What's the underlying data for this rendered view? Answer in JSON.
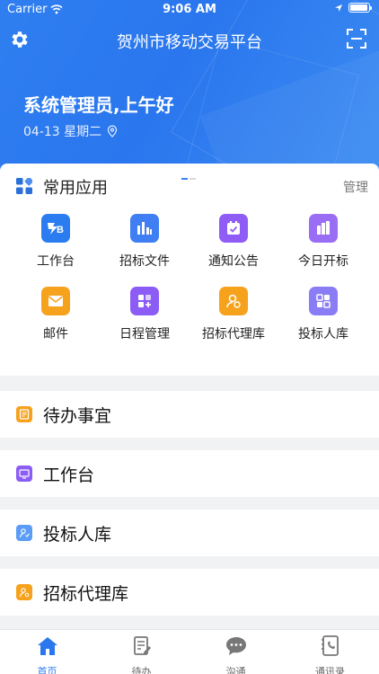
{
  "status_bar": {
    "carrier": "Carrier",
    "time": "9:06 AM"
  },
  "header": {
    "title": "贺州市移动交易平台",
    "greeting": "系统管理员,上午好",
    "date": "04-13 星期二"
  },
  "apps": {
    "title": "常用应用",
    "manage_label": "管理",
    "items": [
      {
        "label": "工作台",
        "icon": "workbench-logo-icon",
        "color": "#2b7cf0"
      },
      {
        "label": "招标文件",
        "icon": "bar-chart-icon",
        "color": "#3f7ef3"
      },
      {
        "label": "通知公告",
        "icon": "calendar-check-icon",
        "color": "#8f5cf6"
      },
      {
        "label": "今日开标",
        "icon": "building-chart-icon",
        "color": "#9a6df5"
      },
      {
        "label": "邮件",
        "icon": "mail-icon",
        "color": "#f6a21c"
      },
      {
        "label": "日程管理",
        "icon": "grid-plus-icon",
        "color": "#8b5cf6"
      },
      {
        "label": "招标代理库",
        "icon": "agent-person-icon",
        "color": "#f6a21c"
      },
      {
        "label": "投标人库",
        "icon": "tiles-icon",
        "color": "#8a7cf5"
      }
    ]
  },
  "sections": [
    {
      "label": "待办事宜",
      "icon": "todo-list-icon",
      "color": "#f6a21c"
    },
    {
      "label": "工作台",
      "icon": "monitor-icon",
      "color": "#8b5cf6"
    },
    {
      "label": "投标人库",
      "icon": "bidder-icon",
      "color": "#5b9cf6"
    },
    {
      "label": "招标代理库",
      "icon": "agent-icon",
      "color": "#f6a21c"
    }
  ],
  "tabbar": {
    "items": [
      {
        "label": "首页",
        "icon": "home-icon",
        "active": true
      },
      {
        "label": "待办",
        "icon": "todo-edit-icon",
        "active": false
      },
      {
        "label": "沟通",
        "icon": "chat-icon",
        "active": false
      },
      {
        "label": "通讯录",
        "icon": "contacts-icon",
        "active": false
      }
    ]
  },
  "colors": {
    "primary": "#2b78ee",
    "background": "#f1f2f4"
  }
}
